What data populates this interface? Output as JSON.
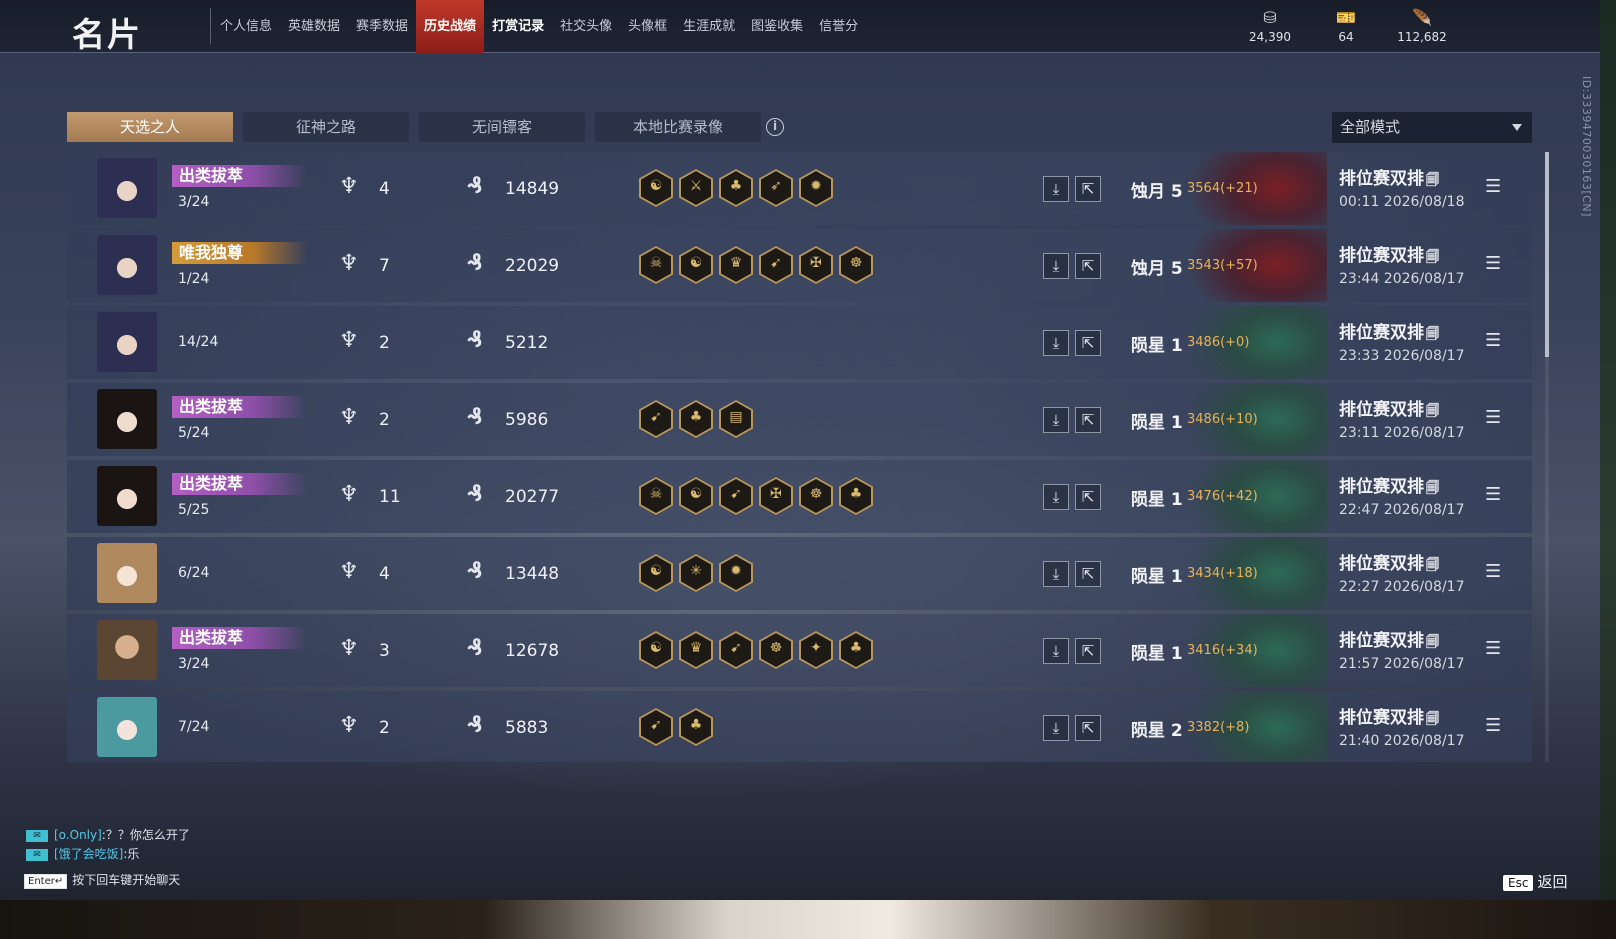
{
  "header": {
    "title": "名片",
    "nav": [
      {
        "label": "个人信息",
        "state": "normal"
      },
      {
        "label": "英雄数据",
        "state": "normal"
      },
      {
        "label": "赛季数据",
        "state": "normal"
      },
      {
        "label": "历史战绩",
        "state": "active"
      },
      {
        "label": "打赏记录",
        "state": "bold"
      },
      {
        "label": "社交头像",
        "state": "normal"
      },
      {
        "label": "头像框",
        "state": "normal"
      },
      {
        "label": "生涯成就",
        "state": "normal"
      },
      {
        "label": "图鉴收集",
        "state": "normal"
      },
      {
        "label": "信誉分",
        "state": "normal"
      }
    ],
    "currencies": [
      {
        "icon": "coin-stack-icon",
        "glyph": "⛁",
        "value": "24,390",
        "color": "#d4d7de"
      },
      {
        "icon": "ticket-icon",
        "glyph": "🎫",
        "value": "64",
        "color": "#e6b441"
      },
      {
        "icon": "feather-icon",
        "glyph": "🪶",
        "value": "112,682",
        "color": "#3fc3cf"
      }
    ]
  },
  "side_id": "ID:3339470030163[CN]",
  "tabs": [
    {
      "label": "天选之人",
      "active": true
    },
    {
      "label": "征神之路",
      "active": false
    },
    {
      "label": "无间镖客",
      "active": false
    },
    {
      "label": "本地比赛录像",
      "active": false
    }
  ],
  "info_icon": "info-icon",
  "mode_select": {
    "value": "全部模式"
  },
  "matches": [
    {
      "avatar": "hood",
      "badge": "出类拔萃",
      "badge_color": "purple",
      "rank": "3/24",
      "kills": "4",
      "score": "14849",
      "medals": [
        "☯",
        "⚔",
        "♣",
        "➶",
        "✹"
      ],
      "tier": "蚀月 5",
      "points": "3564(+21)",
      "emblem": "red",
      "match_type": "排位赛双排",
      "time": "00:11  2026/08/18"
    },
    {
      "avatar": "hood",
      "badge": "唯我独尊",
      "badge_color": "gold",
      "rank": "1/24",
      "kills": "7",
      "score": "22029",
      "medals": [
        "☠",
        "☯",
        "♛",
        "➹",
        "✠",
        "☸"
      ],
      "tier": "蚀月 5",
      "points": "3543(+57)",
      "emblem": "red",
      "match_type": "排位赛双排",
      "time": "23:44  2026/08/17"
    },
    {
      "avatar": "hood",
      "badge": "",
      "badge_color": "",
      "rank": "14/24",
      "kills": "2",
      "score": "5212",
      "medals": [],
      "tier": "陨星 1",
      "points": "3486(+0)",
      "emblem": "green",
      "match_type": "排位赛双排",
      "time": "23:33  2026/08/17"
    },
    {
      "avatar": "girl",
      "badge": "出类拔萃",
      "badge_color": "purple",
      "rank": "5/24",
      "kills": "2",
      "score": "5986",
      "medals": [
        "➹",
        "♣",
        "▤"
      ],
      "tier": "陨星 1",
      "points": "3486(+10)",
      "emblem": "green",
      "match_type": "排位赛双排",
      "time": "23:11  2026/08/17"
    },
    {
      "avatar": "girl",
      "badge": "出类拔萃",
      "badge_color": "purple",
      "rank": "5/25",
      "kills": "11",
      "score": "20277",
      "medals": [
        "☠",
        "☯",
        "➹",
        "✠",
        "☸",
        "♣"
      ],
      "tier": "陨星 1",
      "points": "3476(+42)",
      "emblem": "green",
      "match_type": "排位赛双排",
      "time": "22:47  2026/08/17"
    },
    {
      "avatar": "flower",
      "badge": "",
      "badge_color": "",
      "rank": "6/24",
      "kills": "4",
      "score": "13448",
      "medals": [
        "☯",
        "✳",
        "✹"
      ],
      "tier": "陨星 1",
      "points": "3434(+18)",
      "emblem": "green",
      "match_type": "排位赛双排",
      "time": "22:27  2026/08/17"
    },
    {
      "avatar": "monk",
      "badge": "出类拔萃",
      "badge_color": "purple",
      "rank": "3/24",
      "kills": "3",
      "score": "12678",
      "medals": [
        "☯",
        "♛",
        "➹",
        "☸",
        "✦",
        "♣"
      ],
      "tier": "陨星 1",
      "points": "3416(+34)",
      "emblem": "green",
      "match_type": "排位赛双排",
      "time": "21:57  2026/08/17"
    },
    {
      "avatar": "teal",
      "badge": "",
      "badge_color": "",
      "rank": "7/24",
      "kills": "2",
      "score": "5883",
      "medals": [
        "➹",
        "♣"
      ],
      "tier": "陨星 2",
      "points": "3382(+8)",
      "emblem": "green",
      "match_type": "排位赛双排",
      "time": "21:40  2026/08/17"
    }
  ],
  "chat": [
    {
      "who": "[o.Only]",
      "msg": ":？？你怎么开了"
    },
    {
      "who": "[饿了会吃饭]",
      "msg": ":乐"
    }
  ],
  "enter_key": "Enter↵",
  "enter_hint": "按下回车键开始聊天",
  "esc_key": "Esc",
  "esc_label": "返回",
  "colors": {
    "accent_red": "#c0392b",
    "tab_active": "#b58a60",
    "points": "#e8b35a",
    "badge_purple": "#b45ec4",
    "badge_gold": "#d79a3a"
  }
}
